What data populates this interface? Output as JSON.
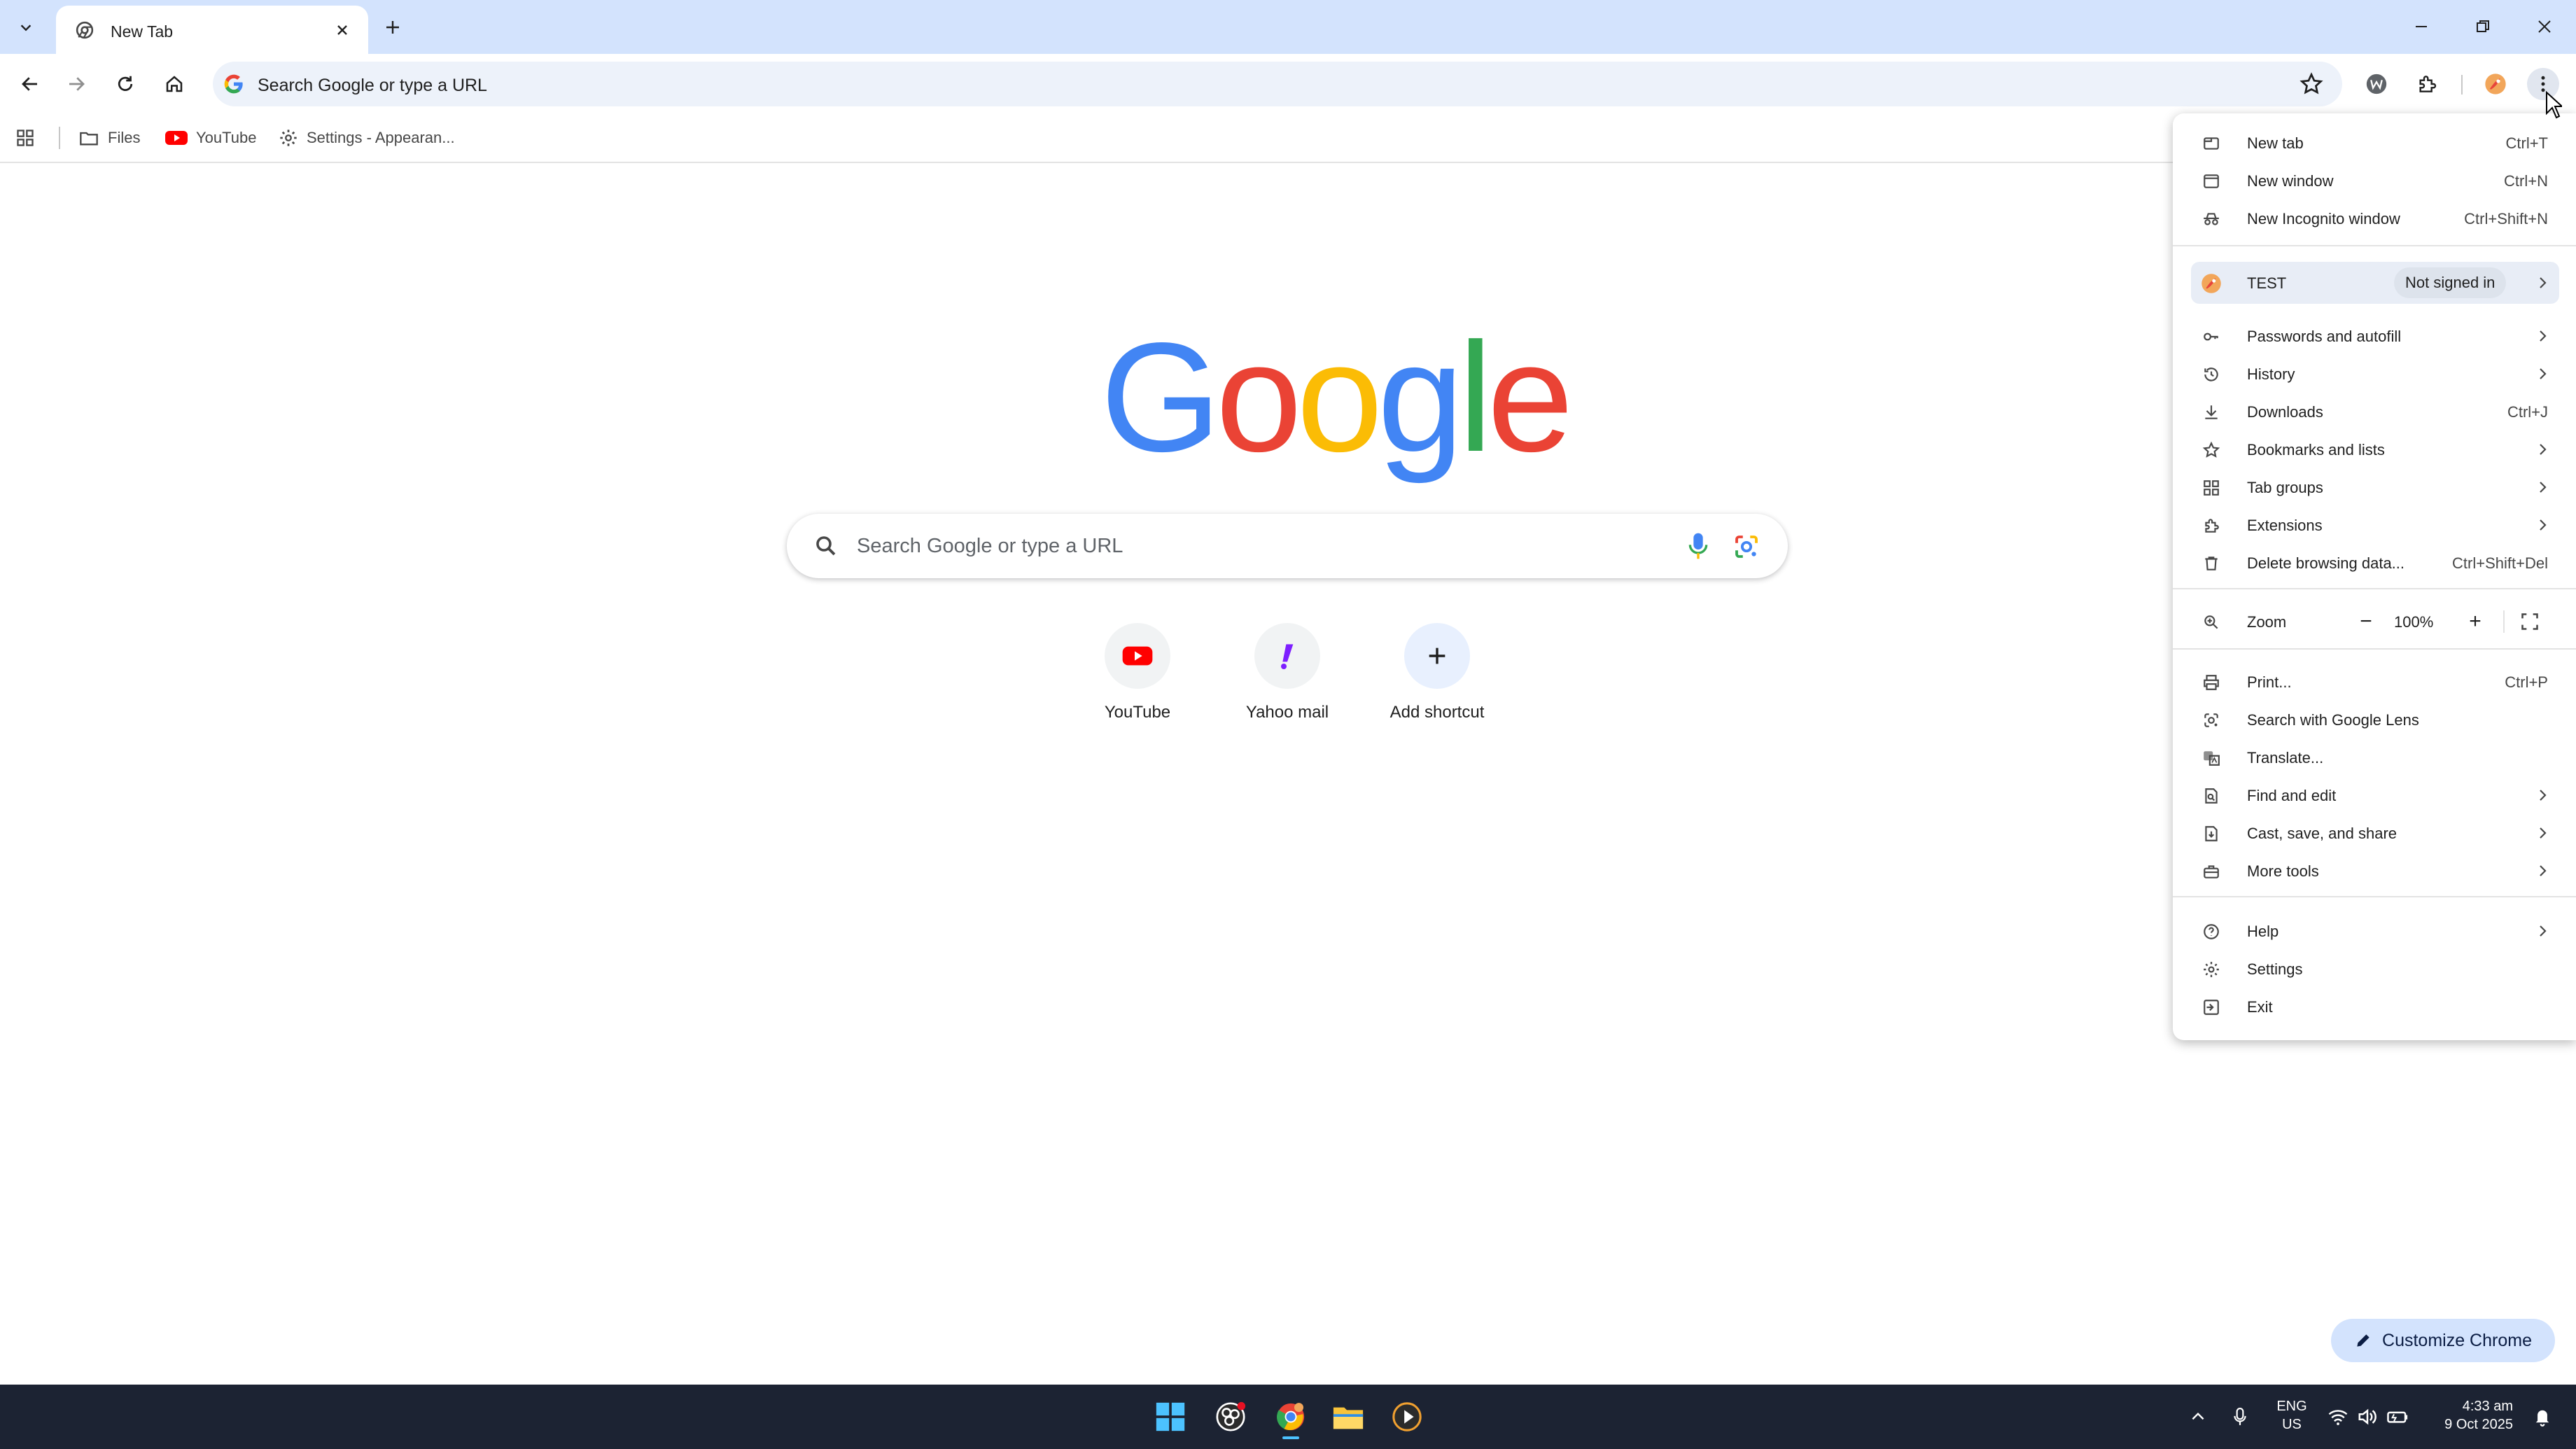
{
  "browser": {
    "tab": {
      "title": "New Tab"
    },
    "omnibox": {
      "placeholder": "Search Google or type a URL"
    }
  },
  "bookmarks": [
    {
      "label": "Files",
      "icon": "folder-icon"
    },
    {
      "label": "YouTube",
      "icon": "youtube-icon"
    },
    {
      "label": "Settings - Appearan...",
      "icon": "gear-icon"
    }
  ],
  "ntp": {
    "logo": [
      "G",
      "o",
      "o",
      "g",
      "l",
      "e"
    ],
    "search_placeholder": "Search Google or type a URL",
    "shortcuts": [
      {
        "label": "YouTube",
        "icon": "youtube-icon"
      },
      {
        "label": "Yahoo mail",
        "icon": "yahoo-icon"
      },
      {
        "label": "Add shortcut",
        "icon": "plus-icon"
      }
    ],
    "customize_label": "Customize Chrome"
  },
  "menu": {
    "new_tab": {
      "label": "New tab",
      "shortcut": "Ctrl+T"
    },
    "new_window": {
      "label": "New window",
      "shortcut": "Ctrl+N"
    },
    "new_incognito": {
      "label": "New Incognito window",
      "shortcut": "Ctrl+Shift+N"
    },
    "profile": {
      "label": "TEST",
      "status": "Not signed in"
    },
    "passwords": {
      "label": "Passwords and autofill"
    },
    "history": {
      "label": "History"
    },
    "downloads": {
      "label": "Downloads",
      "shortcut": "Ctrl+J"
    },
    "bookmarks": {
      "label": "Bookmarks and lists"
    },
    "tab_groups": {
      "label": "Tab groups"
    },
    "extensions": {
      "label": "Extensions"
    },
    "delete_data": {
      "label": "Delete browsing data...",
      "shortcut": "Ctrl+Shift+Del"
    },
    "zoom": {
      "label": "Zoom",
      "minus": "−",
      "value": "100%",
      "plus": "+"
    },
    "print": {
      "label": "Print...",
      "shortcut": "Ctrl+P"
    },
    "lens": {
      "label": "Search with Google Lens"
    },
    "translate": {
      "label": "Translate..."
    },
    "find_edit": {
      "label": "Find and edit"
    },
    "cast": {
      "label": "Cast, save, and share"
    },
    "more_tools": {
      "label": "More tools"
    },
    "help": {
      "label": "Help"
    },
    "settings": {
      "label": "Settings"
    },
    "exit": {
      "label": "Exit"
    }
  },
  "taskbar": {
    "lang_top": "ENG",
    "lang_bottom": "US",
    "time": "4:33 am",
    "date": "9 Oct 2025"
  },
  "colors": {
    "tabstrip": "#d3e3fd",
    "omnibox": "#edf2fa",
    "google_blue": "#4285f4",
    "google_red": "#ea4335",
    "google_yellow": "#fbbc05",
    "google_green": "#34a853",
    "taskbar": "#1c2333"
  }
}
